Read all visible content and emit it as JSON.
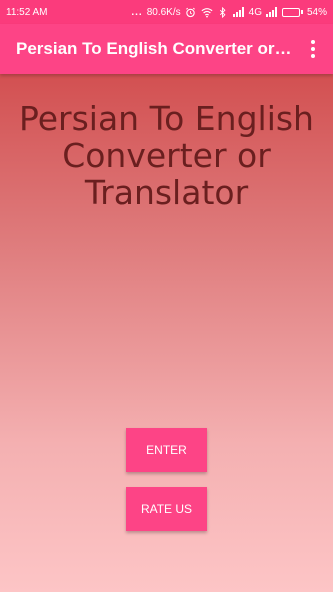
{
  "status_bar": {
    "time": "11:52 AM",
    "dots": "...",
    "network_speed": "80.6K/s",
    "network_type": "4G",
    "battery_percent": "54%",
    "battery_level": 0.54,
    "icons": [
      "alarm-icon",
      "wifi-icon",
      "bluetooth-icon",
      "signal-icon",
      "signal-icon",
      "battery-icon"
    ]
  },
  "app_bar": {
    "title": "Persian To English Converter or Translator",
    "menu_icon": "more-vert-icon"
  },
  "main": {
    "heading": "Persian To English Converter or Translator",
    "enter_label": "ENTER",
    "rate_label": "RATE US"
  },
  "colors": {
    "primary": "#fd4486",
    "status_bar": "#fb3b7c",
    "heading_text": "#6a1f1f",
    "gradient_top": "#cd3d3e",
    "gradient_bottom": "#fdc5c6"
  }
}
